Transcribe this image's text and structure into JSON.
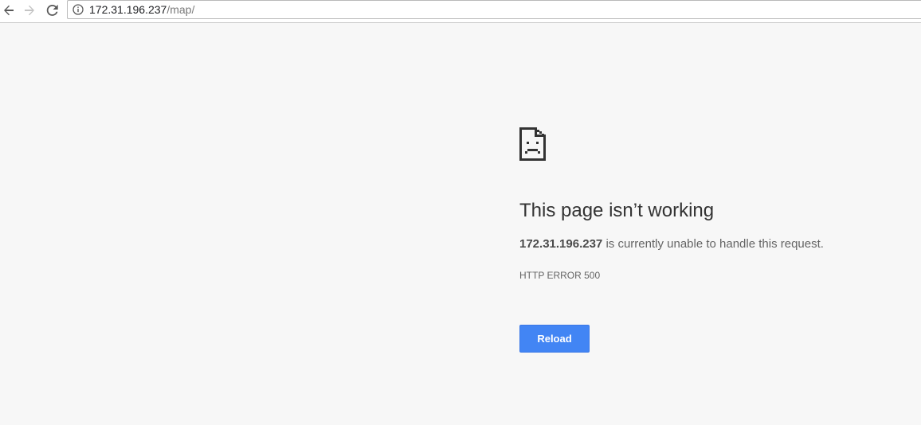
{
  "browser": {
    "url_host": "172.31.196.237",
    "url_path": "/map/"
  },
  "icons": {
    "back": "back-arrow-icon",
    "forward": "forward-arrow-icon",
    "reload": "reload-icon",
    "info": "info-icon",
    "sad_page": "sad-page-icon"
  },
  "error": {
    "headline": "This page isn’t working",
    "host": "172.31.196.237",
    "message_suffix": " is currently unable to handle this request.",
    "code": "HTTP ERROR 500",
    "reload_label": "Reload"
  },
  "colors": {
    "page_background": "#f7f7f7",
    "button_blue": "#4285f4",
    "headline_text": "#333333",
    "body_text": "#646464"
  }
}
